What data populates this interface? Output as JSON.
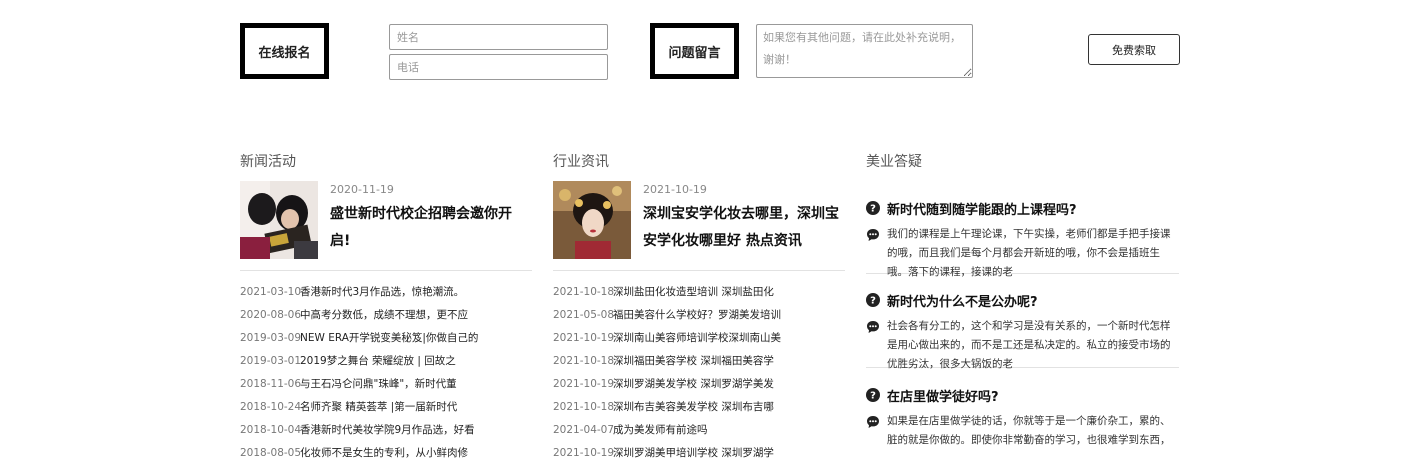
{
  "form": {
    "signup_label": "在线报名",
    "name_placeholder": "姓名",
    "phone_placeholder": "电话",
    "message_label": "问题留言",
    "message_placeholder": "如果您有其他问题，请在此处补充说明，谢谢！",
    "submit_label": "免费索取"
  },
  "news": {
    "title": "新闻活动",
    "featured": {
      "date": "2020-11-19",
      "title": "盛世新时代校企招聘会邀你开启!"
    },
    "items": [
      {
        "date": "2021-03-10",
        "text": "香港新时代3月作品选，惊艳潮流。"
      },
      {
        "date": "2020-08-06",
        "text": "中高考分数低，成绩不理想，更不应"
      },
      {
        "date": "2019-03-09",
        "text": "NEW ERA开学锐变美秘笈|你做自己的"
      },
      {
        "date": "2019-03-01",
        "text": "2019梦之舞台 荣耀绽放 | 回故之"
      },
      {
        "date": "2018-11-06",
        "text": "与王石冯仑问鼎\"珠峰\"，新时代董"
      },
      {
        "date": "2018-10-24",
        "text": "名师齐聚 精英荟萃 |第一届新时代"
      },
      {
        "date": "2018-10-04",
        "text": "香港新时代美妆学院9月作品选，好看"
      },
      {
        "date": "2018-08-05",
        "text": "化妆师不是女生的专利，从小鲜肉修"
      }
    ]
  },
  "industry": {
    "title": "行业资讯",
    "featured": {
      "date": "2021-10-19",
      "title": "深圳宝安学化妆去哪里，深圳宝安学化妆哪里好 热点资讯"
    },
    "items": [
      {
        "date": "2021-10-18",
        "text": "深圳盐田化妆造型培训 深圳盐田化"
      },
      {
        "date": "2021-05-08",
        "text": "福田美容什么学校好？罗湖美发培训"
      },
      {
        "date": "2021-10-19",
        "text": "深圳南山美容师培训学校深圳南山美"
      },
      {
        "date": "2021-10-18",
        "text": "深圳福田美容学校 深圳福田美容学"
      },
      {
        "date": "2021-10-19",
        "text": "深圳罗湖美发学校 深圳罗湖学美发"
      },
      {
        "date": "2021-10-18",
        "text": "深圳布吉美容美发学校 深圳布吉哪"
      },
      {
        "date": "2021-04-07",
        "text": "成为美发师有前途吗"
      },
      {
        "date": "2021-10-19",
        "text": "深圳罗湖美甲培训学校 深圳罗湖学"
      }
    ]
  },
  "faq": {
    "title": "美业答疑",
    "items": [
      {
        "q": "新时代随到随学能跟的上课程吗?",
        "a": "我们的课程是上午理论课，下午实操，老师们都是手把手接课的哦，而且我们是每个月都会开新班的哦，你不会是插班生哦。落下的课程，接课的老"
      },
      {
        "q": "新时代为什么不是公办呢?",
        "a": "社会各有分工的，这个和学习是没有关系的，一个新时代怎样是用心做出来的，而不是工还是私决定的。私立的接受市场的优胜劣汰，很多大锅饭的老"
      },
      {
        "q": "在店里做学徒好吗?",
        "a": "如果是在店里做学徒的话，你就等于是一个廉价杂工，累的、脏的就是你做的。即使你非常勤奋的学习，也很难学到东西，"
      }
    ]
  }
}
